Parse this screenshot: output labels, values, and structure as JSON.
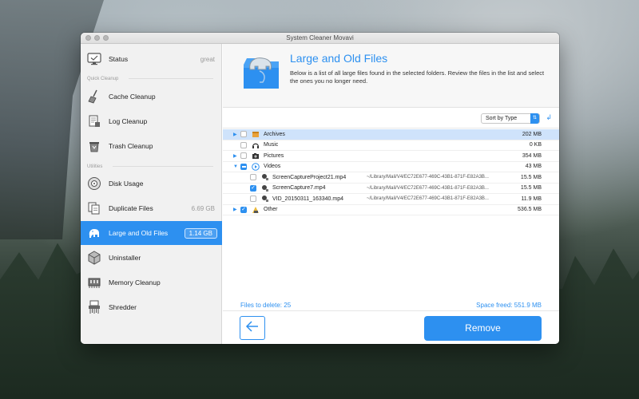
{
  "window": {
    "title": "System Cleaner Movavi"
  },
  "sidebar": {
    "items": [
      {
        "label": "Status",
        "value": "great",
        "icon": "monitor-icon"
      },
      {
        "label": "Cache Cleanup",
        "icon": "broom-icon"
      },
      {
        "label": "Log Cleanup",
        "icon": "log-icon"
      },
      {
        "label": "Trash Cleanup",
        "icon": "trash-icon"
      },
      {
        "label": "Disk Usage",
        "icon": "disk-icon"
      },
      {
        "label": "Duplicate Files",
        "value": "6.69 GB",
        "icon": "duplicate-icon"
      },
      {
        "label": "Large and Old Files",
        "value": "1.14 GB",
        "icon": "elephant-icon",
        "active": true
      },
      {
        "label": "Uninstaller",
        "icon": "box-icon"
      },
      {
        "label": "Memory Cleanup",
        "icon": "memory-icon"
      },
      {
        "label": "Shredder",
        "icon": "shredder-icon"
      }
    ],
    "sections": {
      "quick": "Quick Cleanup",
      "utilities": "Utilities"
    }
  },
  "header": {
    "title": "Large and Old Files",
    "description": "Below is a list of all large files found in the selected folders. Review the files in the list and select the ones you no longer need."
  },
  "sort": {
    "label": "Sort by Type"
  },
  "files": [
    {
      "name": "Archives",
      "size": "202 MB",
      "expandable": true,
      "checked": "off",
      "selected": true,
      "icon": "archive-icon"
    },
    {
      "name": "Music",
      "size": "0 KB",
      "expandable": false,
      "checked": "off",
      "icon": "headphones-icon"
    },
    {
      "name": "Pictures",
      "size": "354 MB",
      "expandable": true,
      "checked": "off",
      "icon": "camera-icon"
    },
    {
      "name": "Videos",
      "size": "43 MB",
      "expandable": true,
      "expanded": true,
      "checked": "mixed",
      "icon": "play-icon"
    },
    {
      "name": "ScreenCaptureProject21.mp4",
      "path": "~/Library/Mail/V4/EC72E677-469C-43B1-871F-E82A3B...",
      "size": "15.5 MB",
      "child": true,
      "checked": "off",
      "icon": "video-file-icon"
    },
    {
      "name": "ScreenCapture7.mp4",
      "path": "~/Library/Mail/V4/EC72E677-469C-43B1-871F-E82A3B...",
      "size": "15.5 MB",
      "child": true,
      "checked": "on",
      "icon": "video-file-icon"
    },
    {
      "name": "VID_20150311_163340.mp4",
      "path": "~/Library/Mail/V4/EC72E677-469C-43B1-871F-E82A3B...",
      "size": "11.9 MB",
      "child": true,
      "checked": "off",
      "icon": "video-file-icon"
    },
    {
      "name": "Other",
      "size": "536.5 MB",
      "expandable": true,
      "checked": "on",
      "icon": "other-icon"
    }
  ],
  "footer": {
    "files_to_delete": "Files to delete: 25",
    "space_freed": "Space freed: 551.9 MB",
    "remove_label": "Remove"
  },
  "colors": {
    "accent": "#2d90f0"
  }
}
